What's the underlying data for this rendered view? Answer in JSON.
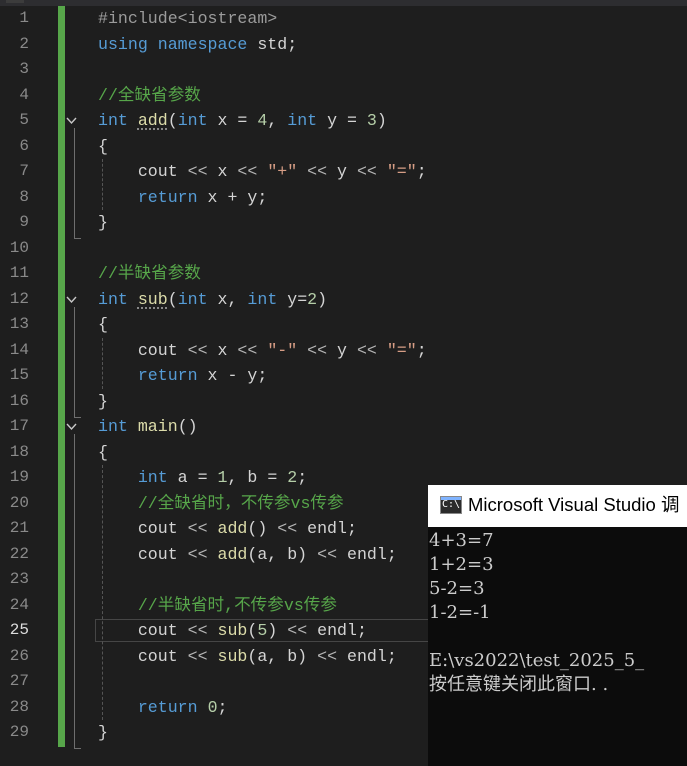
{
  "editor": {
    "current_line": 25,
    "lines": [
      {
        "n": "1",
        "tokens": [
          {
            "t": "#include<iostream>",
            "c": "pp"
          }
        ]
      },
      {
        "n": "2",
        "tokens": [
          {
            "t": "using",
            "c": "kw"
          },
          {
            "t": " "
          },
          {
            "t": "namespace",
            "c": "kw"
          },
          {
            "t": " std;"
          }
        ]
      },
      {
        "n": "3",
        "tokens": []
      },
      {
        "n": "4",
        "tokens": [
          {
            "t": "//全缺省参数",
            "c": "cm"
          }
        ]
      },
      {
        "n": "5",
        "tokens": [
          {
            "t": "int",
            "c": "kw"
          },
          {
            "t": " "
          },
          {
            "t": "add",
            "c": "fn wavy"
          },
          {
            "t": "("
          },
          {
            "t": "int",
            "c": "kw"
          },
          {
            "t": " x = "
          },
          {
            "t": "4",
            "c": "nm"
          },
          {
            "t": ", "
          },
          {
            "t": "int",
            "c": "kw"
          },
          {
            "t": " y = "
          },
          {
            "t": "3",
            "c": "nm"
          },
          {
            "t": ")"
          }
        ]
      },
      {
        "n": "6",
        "tokens": [
          {
            "t": "{"
          }
        ]
      },
      {
        "n": "7",
        "tokens": [
          {
            "t": "    cout "
          },
          {
            "t": "<<",
            "c": "op"
          },
          {
            "t": " x "
          },
          {
            "t": "<<",
            "c": "op"
          },
          {
            "t": " "
          },
          {
            "t": "\"+\"",
            "c": "st"
          },
          {
            "t": " "
          },
          {
            "t": "<<",
            "c": "op"
          },
          {
            "t": " y "
          },
          {
            "t": "<<",
            "c": "op"
          },
          {
            "t": " "
          },
          {
            "t": "\"=\"",
            "c": "st"
          },
          {
            "t": ";"
          }
        ]
      },
      {
        "n": "8",
        "tokens": [
          {
            "t": "    "
          },
          {
            "t": "return",
            "c": "kw"
          },
          {
            "t": " x + y;"
          }
        ]
      },
      {
        "n": "9",
        "tokens": [
          {
            "t": "}"
          }
        ]
      },
      {
        "n": "10",
        "tokens": []
      },
      {
        "n": "11",
        "tokens": [
          {
            "t": "//半缺省参数",
            "c": "cm"
          }
        ]
      },
      {
        "n": "12",
        "tokens": [
          {
            "t": "int",
            "c": "kw"
          },
          {
            "t": " "
          },
          {
            "t": "sub",
            "c": "fn wavy"
          },
          {
            "t": "("
          },
          {
            "t": "int",
            "c": "kw"
          },
          {
            "t": " x, "
          },
          {
            "t": "int",
            "c": "kw"
          },
          {
            "t": " y="
          },
          {
            "t": "2",
            "c": "nm"
          },
          {
            "t": ")"
          }
        ]
      },
      {
        "n": "13",
        "tokens": [
          {
            "t": "{"
          }
        ]
      },
      {
        "n": "14",
        "tokens": [
          {
            "t": "    cout "
          },
          {
            "t": "<<",
            "c": "op"
          },
          {
            "t": " x "
          },
          {
            "t": "<<",
            "c": "op"
          },
          {
            "t": " "
          },
          {
            "t": "\"-\"",
            "c": "st"
          },
          {
            "t": " "
          },
          {
            "t": "<<",
            "c": "op"
          },
          {
            "t": " y "
          },
          {
            "t": "<<",
            "c": "op"
          },
          {
            "t": " "
          },
          {
            "t": "\"=\"",
            "c": "st"
          },
          {
            "t": ";"
          }
        ]
      },
      {
        "n": "15",
        "tokens": [
          {
            "t": "    "
          },
          {
            "t": "return",
            "c": "kw"
          },
          {
            "t": " x - y;"
          }
        ]
      },
      {
        "n": "16",
        "tokens": [
          {
            "t": "}"
          }
        ]
      },
      {
        "n": "17",
        "tokens": [
          {
            "t": "int",
            "c": "kw"
          },
          {
            "t": " "
          },
          {
            "t": "main",
            "c": "fn"
          },
          {
            "t": "()"
          }
        ]
      },
      {
        "n": "18",
        "tokens": [
          {
            "t": "{"
          }
        ]
      },
      {
        "n": "19",
        "tokens": [
          {
            "t": "    "
          },
          {
            "t": "int",
            "c": "kw"
          },
          {
            "t": " a = "
          },
          {
            "t": "1",
            "c": "nm"
          },
          {
            "t": ", b = "
          },
          {
            "t": "2",
            "c": "nm"
          },
          {
            "t": ";"
          }
        ]
      },
      {
        "n": "20",
        "tokens": [
          {
            "t": "    "
          },
          {
            "t": "//全缺省时，不传参vs传参",
            "c": "cm"
          }
        ]
      },
      {
        "n": "21",
        "tokens": [
          {
            "t": "    cout "
          },
          {
            "t": "<<",
            "c": "op"
          },
          {
            "t": " "
          },
          {
            "t": "add",
            "c": "fn"
          },
          {
            "t": "() "
          },
          {
            "t": "<<",
            "c": "op"
          },
          {
            "t": " endl;"
          }
        ]
      },
      {
        "n": "22",
        "tokens": [
          {
            "t": "    cout "
          },
          {
            "t": "<<",
            "c": "op"
          },
          {
            "t": " "
          },
          {
            "t": "add",
            "c": "fn"
          },
          {
            "t": "(a, b) "
          },
          {
            "t": "<<",
            "c": "op"
          },
          {
            "t": " endl;"
          }
        ]
      },
      {
        "n": "23",
        "tokens": []
      },
      {
        "n": "24",
        "tokens": [
          {
            "t": "    "
          },
          {
            "t": "//半缺省时,不传参vs传参",
            "c": "cm"
          }
        ]
      },
      {
        "n": "25",
        "tokens": [
          {
            "t": "    cout "
          },
          {
            "t": "<<",
            "c": "op"
          },
          {
            "t": " "
          },
          {
            "t": "sub",
            "c": "fn"
          },
          {
            "t": "("
          },
          {
            "t": "5",
            "c": "nm"
          },
          {
            "t": ") "
          },
          {
            "t": "<<",
            "c": "op"
          },
          {
            "t": " endl;"
          }
        ]
      },
      {
        "n": "26",
        "tokens": [
          {
            "t": "    cout "
          },
          {
            "t": "<<",
            "c": "op"
          },
          {
            "t": " "
          },
          {
            "t": "sub",
            "c": "fn"
          },
          {
            "t": "(a, b) "
          },
          {
            "t": "<<",
            "c": "op"
          },
          {
            "t": " endl;"
          }
        ]
      },
      {
        "n": "27",
        "tokens": []
      },
      {
        "n": "28",
        "tokens": [
          {
            "t": "    "
          },
          {
            "t": "return",
            "c": "kw"
          },
          {
            "t": " "
          },
          {
            "t": "0",
            "c": "nm"
          },
          {
            "t": ";"
          }
        ]
      },
      {
        "n": "29",
        "tokens": [
          {
            "t": "}"
          }
        ]
      }
    ],
    "fold_lines": [
      "5",
      "12",
      "17"
    ],
    "colors": {
      "background": "#1e1e1e",
      "keyword": "#569cd6",
      "comment": "#57a64a",
      "string": "#d69d85",
      "change_bar": "#57a64a"
    }
  },
  "console": {
    "title": "Microsoft Visual Studio 调",
    "icon": "console-app-icon",
    "icon_text": "C:\\",
    "output": [
      "4+3=7",
      "1+2=3",
      "5-2=3",
      "1-2=-1",
      "",
      "E:\\vs2022\\test_2025_5_",
      "按任意键关闭此窗口. ."
    ]
  }
}
